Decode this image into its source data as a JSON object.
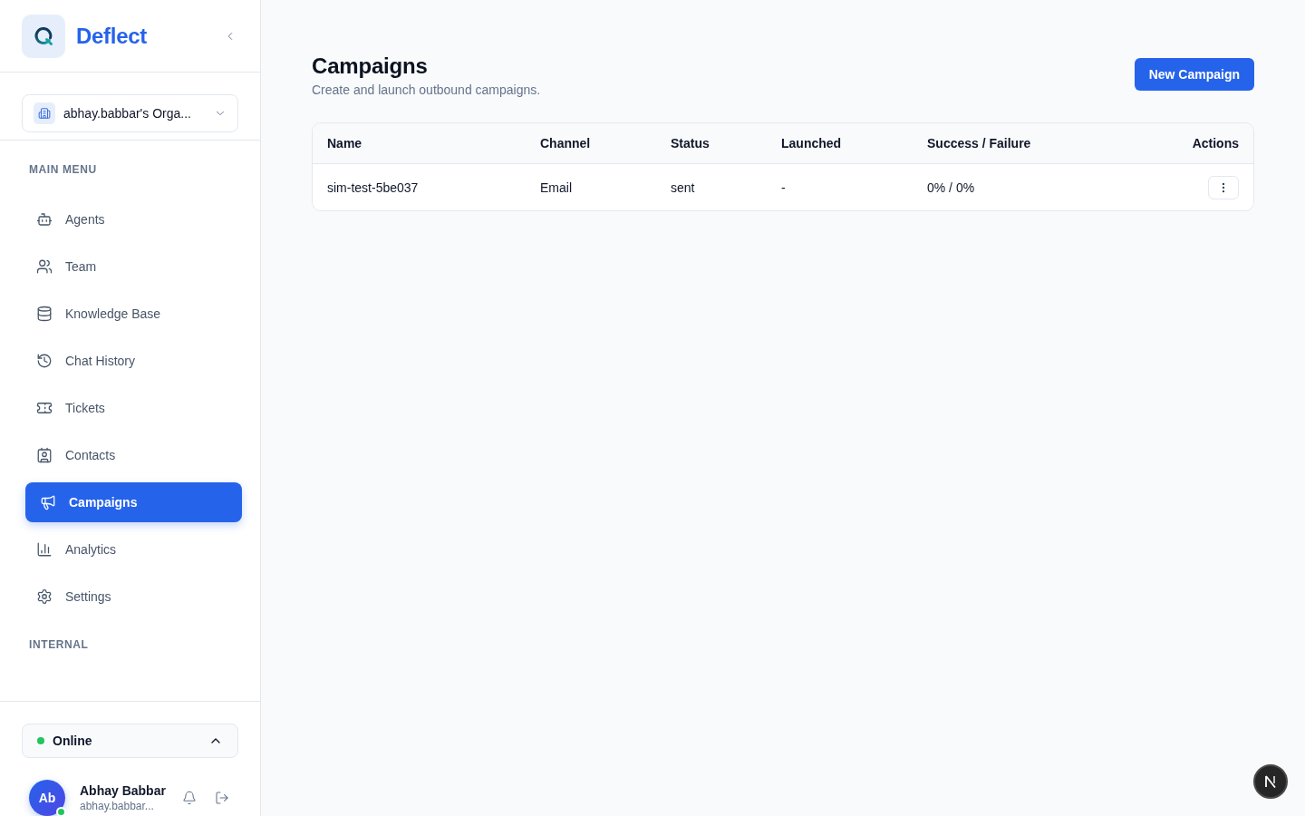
{
  "brand": {
    "name": "Deflect"
  },
  "organization": {
    "name": "abhay.babbar's Orga..."
  },
  "menu_sections": [
    {
      "title": "MAIN MENU",
      "items": [
        {
          "label": "Agents",
          "selected": false
        },
        {
          "label": "Team",
          "selected": false
        },
        {
          "label": "Knowledge Base",
          "selected": false
        },
        {
          "label": "Chat History",
          "selected": false
        },
        {
          "label": "Tickets",
          "selected": false
        },
        {
          "label": "Contacts",
          "selected": false
        },
        {
          "label": "Campaigns",
          "selected": true
        },
        {
          "label": "Analytics",
          "selected": false
        },
        {
          "label": "Settings",
          "selected": false
        }
      ]
    },
    {
      "title": "INTERNAL"
    }
  ],
  "status_select": {
    "label": "Online"
  },
  "user": {
    "initials": "Ab",
    "name": "Abhay Babbar",
    "email": "abhay.babbar...",
    "online": true
  },
  "page": {
    "title": "Campaigns",
    "subtitle": "Create and launch outbound campaigns.",
    "primary_action": "New Campaign"
  },
  "table": {
    "columns": [
      "Name",
      "Channel",
      "Status",
      "Launched",
      "Success / Failure",
      "Actions"
    ],
    "rows": [
      {
        "cells": [
          "sim-test-5be037",
          "Email",
          "sent",
          "-",
          "0% / 0%"
        ]
      }
    ]
  }
}
